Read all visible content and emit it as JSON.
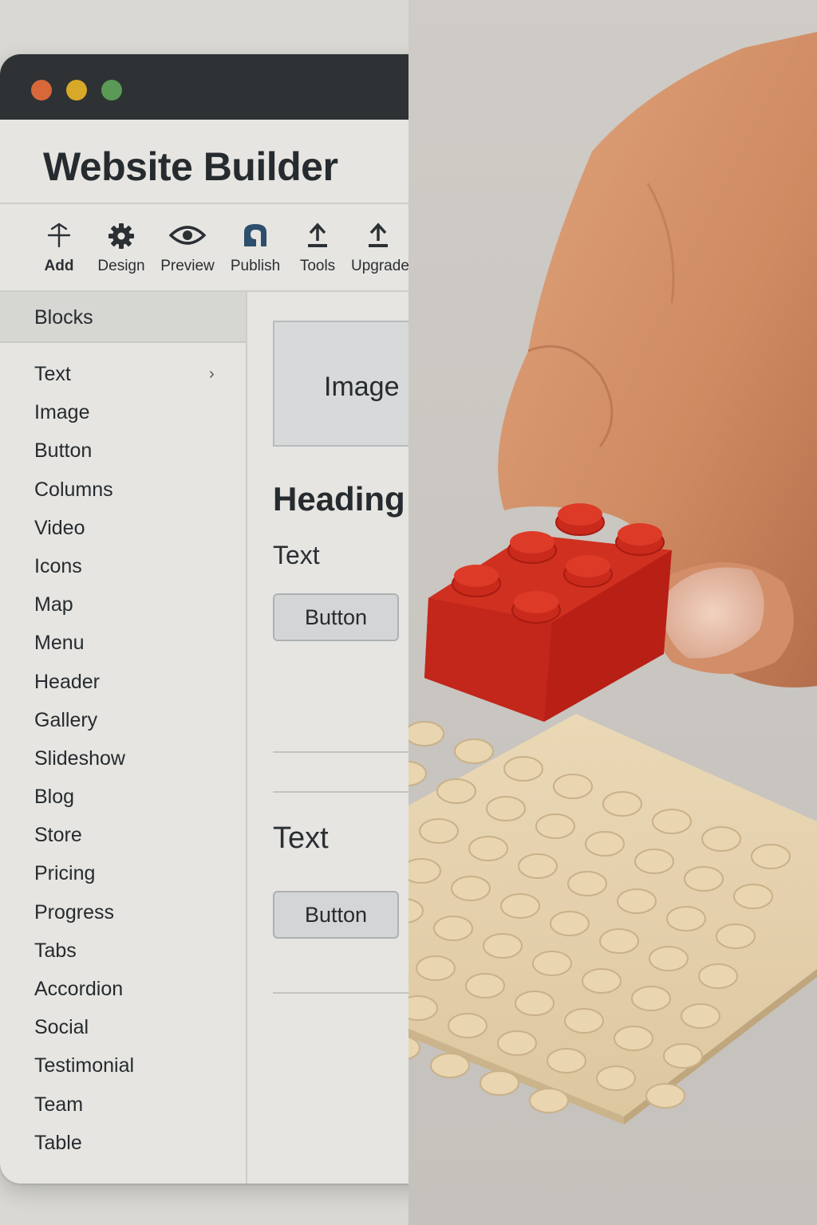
{
  "app": {
    "title": "Website Builder"
  },
  "toolbar": {
    "items": [
      {
        "label": "Add",
        "icon": "add-icon"
      },
      {
        "label": "Design",
        "icon": "gear-icon"
      },
      {
        "label": "Preview",
        "icon": "eye-icon"
      },
      {
        "label": "Publish",
        "icon": "publish-icon"
      },
      {
        "label": "Tools",
        "icon": "upload-icon"
      },
      {
        "label": "Upgrade",
        "icon": "upload-icon"
      }
    ]
  },
  "sidebar": {
    "header": "Blocks",
    "items": [
      "Text",
      "Image",
      "Button",
      "Columns",
      "Video",
      "Icons",
      "Map",
      "Menu",
      "Header",
      "Gallery",
      "Slideshow",
      "Blog",
      "Store",
      "Pricing",
      "Progress",
      "Tabs",
      "Accordion",
      "Social",
      "Testimonial",
      "Team",
      "Table"
    ]
  },
  "canvas": {
    "image_placeholder": "Image",
    "heading": "Heading",
    "text_1": "Text",
    "button_1": "Button",
    "text_2": "Text",
    "button_2": "Button"
  },
  "colors": {
    "titlebar": "#2e3234",
    "close_dot": "#d8673a",
    "minimize_dot": "#d8a829",
    "maximize_dot": "#5b9a56",
    "brick_red": "#c8281e",
    "baseplate_tan": "#e6d3b0"
  }
}
